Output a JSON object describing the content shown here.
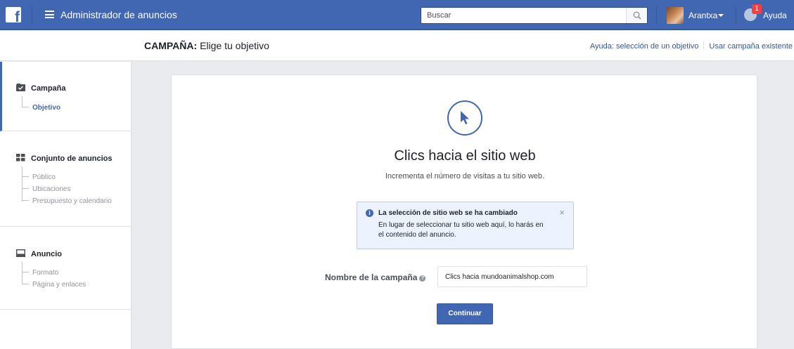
{
  "topbar": {
    "logo_letter": "f",
    "app_title": "Administrador de anuncios",
    "search_placeholder": "Buscar",
    "user_name": "Arantxa",
    "notifications_count": "1",
    "help_label": "Ayuda"
  },
  "subheader": {
    "title_prefix": "CAMPAÑA:",
    "title_rest": " Elige tu objetivo",
    "links": [
      "Ayuda: selección de un objetivo",
      "Usar campaña existente"
    ]
  },
  "sidebar": {
    "campaign": {
      "label": "Campaña",
      "items": [
        "Objetivo"
      ]
    },
    "adset": {
      "label": "Conjunto de anuncios",
      "items": [
        "Público",
        "Ubicaciones",
        "Presupuesto y calendario"
      ]
    },
    "ad": {
      "label": "Anuncio",
      "items": [
        "Formato",
        "Página y enlaces"
      ]
    }
  },
  "main": {
    "objective_title": "Clics hacia el sitio web",
    "objective_desc": "Incrementa el número de visitas a tu sitio web.",
    "notice": {
      "title": "La selección de sitio web se ha cambiado",
      "body": "En lugar de seleccionar tu sitio web aquí, lo harás en el contenido del anuncio.",
      "close": "×"
    },
    "campaign_name_label": "Nombre de la campaña",
    "campaign_name_value": "Clics hacia mundoanimalshop.com",
    "continue_button": "Continuar"
  },
  "colors": {
    "brand": "#4267b2",
    "page_bg": "#e9ebee",
    "notice_bg": "#ecf3ff"
  },
  "icons": [
    "facebook-logo",
    "hamburger-icon",
    "search-icon",
    "caret-down-icon",
    "globe-icon",
    "campaign-icon",
    "adset-grid-icon",
    "ad-icon",
    "cursor-icon",
    "info-icon",
    "close-icon",
    "help-icon"
  ]
}
